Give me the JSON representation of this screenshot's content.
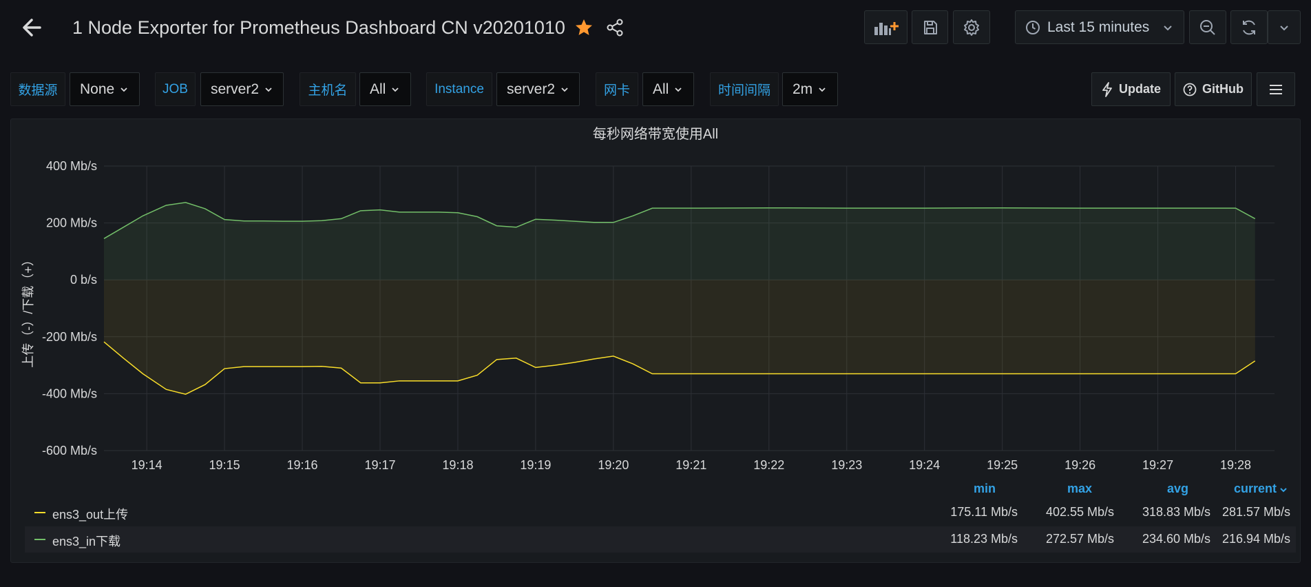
{
  "header": {
    "title": "1 Node Exporter for Prometheus Dashboard CN v20201010",
    "time_range": "Last 15 minutes"
  },
  "variables": [
    {
      "label": "数据源",
      "value": "None"
    },
    {
      "label": "JOB",
      "value": "server2"
    },
    {
      "label": "主机名",
      "value": "All"
    },
    {
      "label": "Instance",
      "value": "server2"
    },
    {
      "label": "网卡",
      "value": "All"
    },
    {
      "label": "时间间隔",
      "value": "2m"
    }
  ],
  "links": {
    "update": "Update",
    "github": "GitHub"
  },
  "colors": {
    "accent_blue": "#33a2e5",
    "star_orange": "#ff9830",
    "series_out": "#fade2a",
    "series_in": "#73bf69"
  },
  "panel": {
    "title": "每秒网络带宽使用All"
  },
  "chart_data": {
    "type": "area",
    "title": "每秒网络带宽使用All",
    "ylabel": "上传（-）/下载（+）",
    "xlabel": "",
    "ylim": [
      -600,
      400
    ],
    "yticks": [
      "400 Mb/s",
      "200 Mb/s",
      "0 b/s",
      "-200 Mb/s",
      "-400 Mb/s",
      "-600 Mb/s"
    ],
    "ytick_values": [
      400,
      200,
      0,
      -200,
      -400,
      -600
    ],
    "xticks": [
      "19:14",
      "19:15",
      "19:16",
      "19:17",
      "19:18",
      "19:19",
      "19:20",
      "19:21",
      "19:22",
      "19:23",
      "19:24",
      "19:25",
      "19:26",
      "19:27",
      "19:28"
    ],
    "xtick_minutes": [
      14,
      15,
      16,
      17,
      18,
      19,
      20,
      21,
      22,
      23,
      24,
      25,
      26,
      27,
      28
    ],
    "xlim_minutes": [
      13.45,
      28.5
    ],
    "grid": true,
    "legend": "bottom",
    "series": [
      {
        "name": "ens3_out上传",
        "color": "#fade2a",
        "x": [
          13.45,
          13.7,
          13.95,
          14.25,
          14.5,
          14.75,
          15.0,
          15.25,
          15.5,
          15.75,
          16.0,
          16.25,
          16.5,
          16.75,
          17.0,
          17.25,
          17.5,
          17.75,
          18.0,
          18.25,
          18.5,
          18.75,
          19.0,
          19.25,
          19.5,
          19.75,
          20.0,
          20.25,
          20.5,
          21.0,
          22.0,
          23.0,
          24.0,
          25.0,
          26.0,
          27.0,
          28.0,
          28.25
        ],
        "values": [
          -218,
          -275,
          -330,
          -385,
          -402,
          -368,
          -312,
          -305,
          -305,
          -305,
          -305,
          -304,
          -310,
          -362,
          -362,
          -355,
          -355,
          -355,
          -355,
          -335,
          -280,
          -275,
          -308,
          -300,
          -290,
          -278,
          -268,
          -295,
          -330,
          -330,
          -330,
          -330,
          -330,
          -330,
          -330,
          -330,
          -330,
          -285
        ]
      },
      {
        "name": "ens3_in下载",
        "color": "#73bf69",
        "x": [
          13.45,
          13.7,
          13.95,
          14.25,
          14.5,
          14.75,
          15.0,
          15.25,
          15.5,
          15.75,
          16.0,
          16.25,
          16.5,
          16.75,
          17.0,
          17.25,
          17.5,
          17.75,
          18.0,
          18.25,
          18.5,
          18.75,
          19.0,
          19.25,
          19.5,
          19.75,
          20.0,
          20.25,
          20.5,
          21.0,
          22.0,
          23.0,
          24.0,
          25.0,
          26.0,
          27.0,
          28.0,
          28.25
        ],
        "values": [
          145,
          185,
          225,
          262,
          272,
          250,
          212,
          207,
          207,
          206,
          206,
          208,
          215,
          243,
          246,
          238,
          238,
          238,
          236,
          222,
          190,
          185,
          213,
          210,
          206,
          202,
          202,
          225,
          252,
          252,
          253,
          252,
          252,
          253,
          252,
          252,
          252,
          215
        ]
      }
    ]
  },
  "legend": {
    "headers": {
      "min": "min",
      "max": "max",
      "avg": "avg",
      "current": "current"
    },
    "rows": [
      {
        "name": "ens3_out上传",
        "color": "#fade2a",
        "min": "175.11 Mb/s",
        "max": "402.55 Mb/s",
        "avg": "318.83 Mb/s",
        "current": "281.57 Mb/s"
      },
      {
        "name": "ens3_in下载",
        "color": "#73bf69",
        "min": "118.23 Mb/s",
        "max": "272.57 Mb/s",
        "avg": "234.60 Mb/s",
        "current": "216.94 Mb/s"
      }
    ]
  }
}
